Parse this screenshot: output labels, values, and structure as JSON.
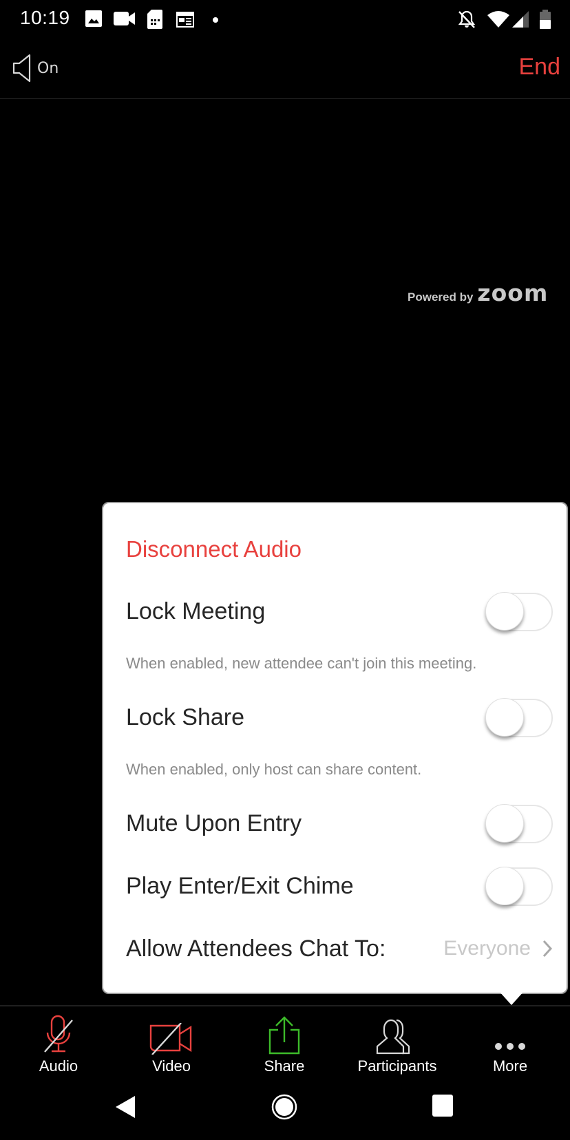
{
  "status_bar": {
    "time": "10:19",
    "left_icons": [
      "image-icon",
      "video-camera-icon",
      "sim-card-icon",
      "calendar-icon",
      "dot-icon"
    ],
    "right_icons": [
      "notifications-off-icon",
      "wifi-icon",
      "cell-signal-icon",
      "battery-icon"
    ]
  },
  "top_bar": {
    "speaker_label": "On",
    "end_label": "End"
  },
  "branding": {
    "powered_by": "Powered by",
    "brand": "ZOOM"
  },
  "menu": {
    "disconnect_audio": "Disconnect Audio",
    "items": [
      {
        "label": "Lock Meeting",
        "enabled": false,
        "description": "When enabled, new attendee can't join this meeting."
      },
      {
        "label": "Lock Share",
        "enabled": false,
        "description": "When enabled, only host can share content."
      },
      {
        "label": "Mute Upon Entry",
        "enabled": false
      },
      {
        "label": "Play Enter/Exit Chime",
        "enabled": false
      }
    ],
    "chat": {
      "label": "Allow Attendees Chat To:",
      "value": "Everyone"
    }
  },
  "toolbar": {
    "items": [
      {
        "label": "Audio",
        "icon": "microphone-muted-icon",
        "color": "#e8413e"
      },
      {
        "label": "Video",
        "icon": "video-off-icon",
        "color": "#e8413e"
      },
      {
        "label": "Share",
        "icon": "share-upload-icon",
        "color": "#3dbb2a"
      },
      {
        "label": "Participants",
        "icon": "participants-icon",
        "color": "#d8d8d8"
      },
      {
        "label": "More",
        "icon": "more-dots-icon",
        "color": "#d8d8d8"
      }
    ]
  },
  "colors": {
    "accent_red": "#e8413e",
    "share_green": "#3dbb2a"
  }
}
